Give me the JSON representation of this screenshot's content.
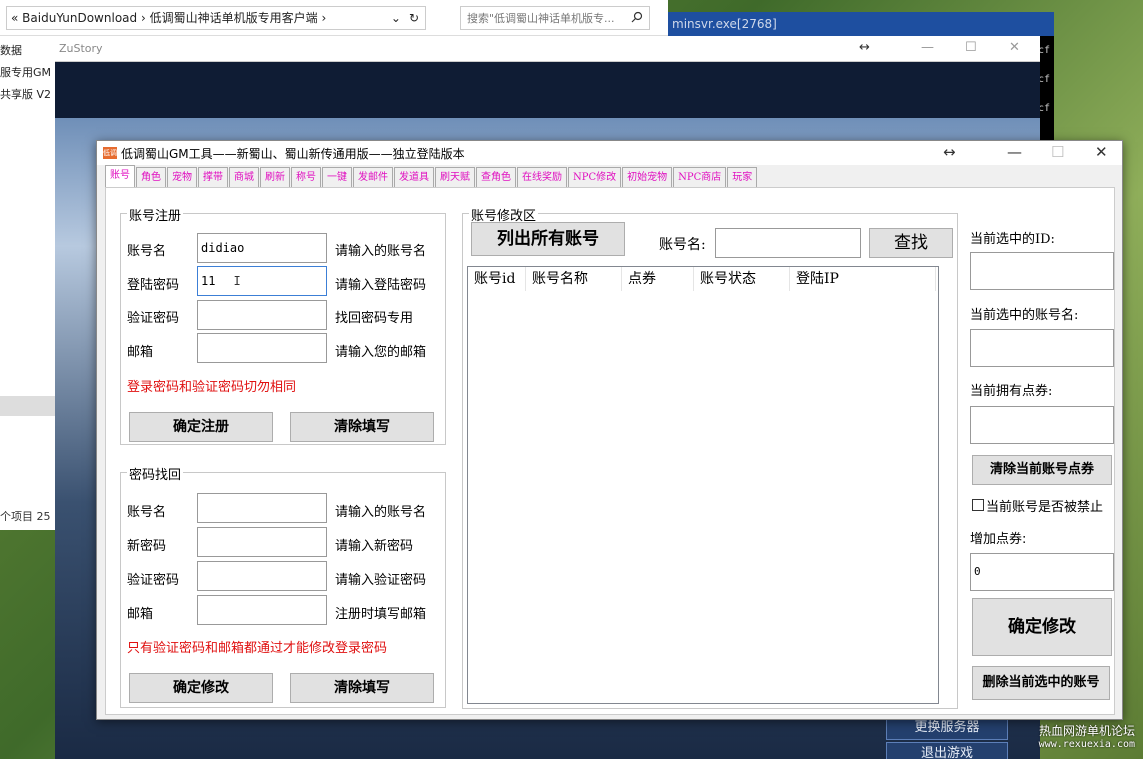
{
  "explorer": {
    "path_prefix": "«",
    "path_items": [
      "BaiduYunDownload",
      "›",
      "低调蜀山神话单机版专用客户端",
      "›"
    ],
    "dropdown_glyph": "⌄",
    "refresh_glyph": "↻",
    "search_placeholder": "搜索\"低调蜀山神话单机版专...",
    "side_items": [
      "数据",
      "服专用GM",
      "共享版 V2"
    ],
    "item_count": "个项目  25"
  },
  "console": {
    "title": "minsvr.exe[2768]",
    "lines": [
      "cf",
      "cf",
      "cf"
    ]
  },
  "zustory": {
    "title": "ZuStory",
    "buttons": [
      "更换服务器",
      "退出游戏"
    ],
    "controls": {
      "resize": "↔",
      "minimize": "—",
      "maximize": "☐",
      "close": "✕"
    }
  },
  "gm": {
    "logo_text": "低调",
    "title": "低调蜀山GM工具——新蜀山、蜀山新传通用版——独立登陆版本",
    "controls": {
      "resize": "↔",
      "minimize": "—",
      "maximize": "☐",
      "close": "✕"
    },
    "tabs": [
      "账号",
      "角色",
      "宠物",
      "撑带",
      "商城",
      "刷新",
      "称号",
      "一键",
      "发邮件",
      "发道具",
      "刷天赋",
      "查角色",
      "在线奖励",
      "NPC修改",
      "初始宠物",
      "NPC商店",
      "玩家"
    ],
    "register": {
      "legend": "账号注册",
      "fields": [
        {
          "label": "账号名",
          "value": "didiao",
          "hint": "请输入的账号名"
        },
        {
          "label": "登陆密码",
          "value": "11",
          "hint": "请输入登陆密码"
        },
        {
          "label": "验证密码",
          "value": "",
          "hint": "找回密码专用"
        },
        {
          "label": "邮箱",
          "value": "",
          "hint": "请输入您的邮箱"
        }
      ],
      "warning": "登录密码和验证密码切勿相同",
      "confirm": "确定注册",
      "clear": "清除填写"
    },
    "recover": {
      "legend": "密码找回",
      "fields": [
        {
          "label": "账号名",
          "value": "",
          "hint": "请输入的账号名"
        },
        {
          "label": "新密码",
          "value": "",
          "hint": "请输入新密码"
        },
        {
          "label": "验证密码",
          "value": "",
          "hint": "请输入验证密码"
        },
        {
          "label": "邮箱",
          "value": "",
          "hint": "注册时填写邮箱"
        }
      ],
      "warning": "只有验证密码和邮箱都通过才能修改登录密码",
      "confirm": "确定修改",
      "clear": "清除填写"
    },
    "modify": {
      "legend": "账号修改区",
      "list_all": "列出所有账号",
      "account_label": "账号名:",
      "account_value": "",
      "find": "查找",
      "columns": [
        "账号id",
        "账号名称",
        "点券",
        "账号状态",
        "登陆IP"
      ]
    },
    "right": {
      "current_id_label": "当前选中的ID:",
      "current_id_value": "",
      "current_name_label": "当前选中的账号名:",
      "current_name_value": "",
      "current_points_label": "当前拥有点券:",
      "current_points_value": "",
      "clear_points": "清除当前账号点券",
      "banned_label": "当前账号是否被禁止",
      "add_points_label": "增加点券:",
      "add_points_value": "0",
      "confirm": "确定修改",
      "delete": "删除当前选中的账号"
    }
  },
  "watermark": {
    "text": "热血网游单机论坛",
    "url": "www.rexuexia.com"
  },
  "colors": {
    "tab_text": "#e010c0",
    "warning": "#e01010",
    "focus": "#3c7fd6"
  }
}
